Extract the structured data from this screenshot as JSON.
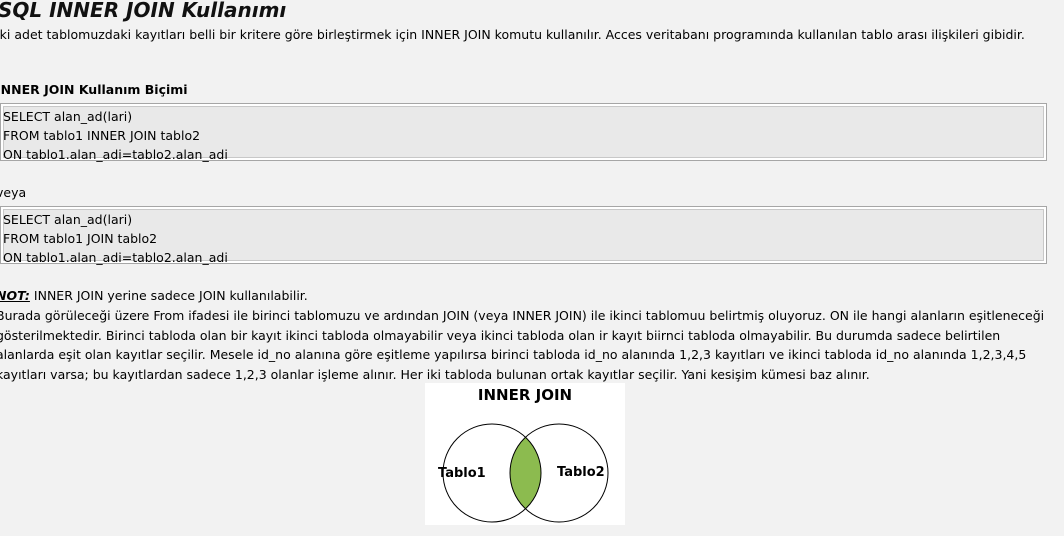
{
  "title": "SQL INNER JOIN Kullanımı",
  "intro": "İki adet tablomuzdaki kayıtları belli bir kritere göre birleştirmek için INNER JOIN komutu kullanılır. Acces veritabanı programında kullanılan tablo arası ilişkileri gibidir.",
  "syntax_heading": "INNER JOIN Kullanım Biçimi",
  "code1": [
    "SELECT alan_ad(lari)",
    "FROM tablo1 INNER JOIN tablo2",
    "ON tablo1.alan_adi=tablo2.alan_adi"
  ],
  "or_text": "veya",
  "code2": [
    "SELECT alan_ad(lari)",
    "FROM tablo1 JOIN tablo2",
    "ON tablo1.alan_adi=tablo2.alan_adi"
  ],
  "note_label": "NOT:",
  "note_text": " INNER JOIN yerine sadece JOIN kullanılabilir.",
  "body": "Burada görüleceği üzere From ifadesi ile birinci tablomuzu ve ardından JOIN (veya INNER JOIN) ile ikinci tablomuu belirtmiş oluyoruz. ON ile hangi alanların eşitleneceği gösterilmektedir. Birinci tabloda olan bir kayıt ikinci tabloda olmayabilir veya ikinci tabloda olan ir kayıt biirnci tabloda olmayabilir. Bu durumda sadece belirtilen alanlarda eşit olan kayıtlar seçilir. Mesele id_no alanına göre eşitleme yapılırsa birinci tabloda id_no alanında 1,2,3 kayıtları ve ikinci tabloda id_no alanında 1,2,3,4,5 kayıtları varsa; bu kayıtlardan sadece 1,2,3 olanlar işleme alınır. Her iki tabloda bulunan ortak kayıtlar seçilir. Yani kesişim kümesi baz alınır.",
  "diagram": {
    "title": "INNER JOIN",
    "left_label": "Tablo1",
    "right_label": "Tablo2",
    "intersection_color": "#8cbb4f"
  }
}
